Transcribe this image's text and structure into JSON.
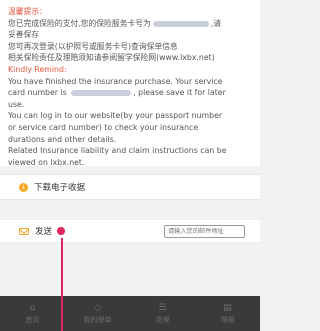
{
  "notice": {
    "title_cn": "温馨提示：",
    "cn_lines": [
      {
        "pre": "您已完成保险的支付,您的保险服务卡号为",
        "post": ",请"
      },
      {
        "pre": "妥善保存",
        "post": ""
      },
      {
        "pre": "您可再次登录(以护照号或服务卡号)查询保单信息",
        "post": ""
      },
      {
        "pre": "相关保险责任及理赔须知请参阅留学保险网(www.lxbx.net)",
        "post": ""
      }
    ],
    "title_en": "Kindly Remind:",
    "en_lines": [
      "You have finished the insurance purchase. Your service",
      {
        "pre": "card number is",
        "post": ", please save it for later"
      },
      "use.",
      "You can log in to our website(by your passport number",
      "or service card number) to check your insurance",
      "durations and other details.",
      "Related Insurance liability and claim instructions can be",
      "viewed on lxbx.net."
    ]
  },
  "download": {
    "label": "下载电子收据",
    "icon": "download-icon",
    "color": "#f5a623"
  },
  "send": {
    "label": "发送",
    "placeholder": "请输入您的邮件地址",
    "icon": "mail-icon"
  },
  "tabs": [
    {
      "label": "首页",
      "icon": "home-icon"
    },
    {
      "label": "我的保单",
      "icon": "shield-icon"
    },
    {
      "label": "退保",
      "icon": "refund-icon"
    },
    {
      "label": "理赔",
      "icon": "claim-icon"
    }
  ]
}
